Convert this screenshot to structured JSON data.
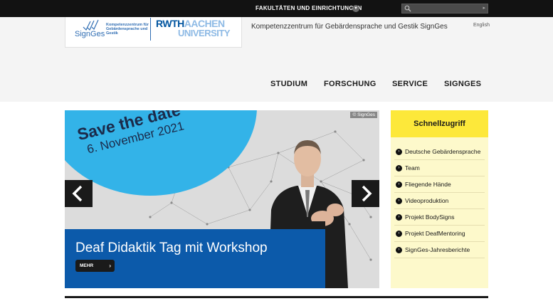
{
  "topbar": {
    "faculties_label": "FAKULTÄTEN UND EINRICHTUNGEN",
    "search_placeholder": ""
  },
  "header": {
    "logo_signges": "SignGes",
    "logo_signges_sub": "Kompetenzzentrum für Gebärdensprache und Gestik",
    "logo_rwth": "RWTH",
    "logo_aachen": "AACHEN",
    "logo_university": "UNIVERSITY",
    "site_title": "Kompetenzzentrum für Gebärdensprache und Gestik SignGes",
    "language": "English"
  },
  "nav": {
    "items": [
      {
        "label": "STUDIUM"
      },
      {
        "label": "FORSCHUNG"
      },
      {
        "label": "SERVICE"
      },
      {
        "label": "SIGNGES"
      }
    ]
  },
  "slider": {
    "save_line1": "Save the date",
    "save_line2": "6. November 2021",
    "copyright": "© SignGes",
    "caption_title": "Deaf Didaktik Tag mit Workshop",
    "more_label": "MEHR",
    "more_arrow": "›",
    "colors": {
      "accent_circle": "#33b3e8",
      "caption_bg": "#0c5aaa"
    }
  },
  "quick": {
    "title": "Schnellzugriff",
    "items": [
      {
        "label": "Deutsche Gebärdensprache"
      },
      {
        "label": "Team"
      },
      {
        "label": "Fliegende Hände"
      },
      {
        "label": "Videoproduktion"
      },
      {
        "label": "Projekt BodySigns"
      },
      {
        "label": "Projekt DeafMentoring"
      },
      {
        "label": "SignGes-Jahresberichte"
      }
    ],
    "colors": {
      "header_bg": "#fde83a",
      "panel_bg": "#fdf9cb"
    }
  }
}
